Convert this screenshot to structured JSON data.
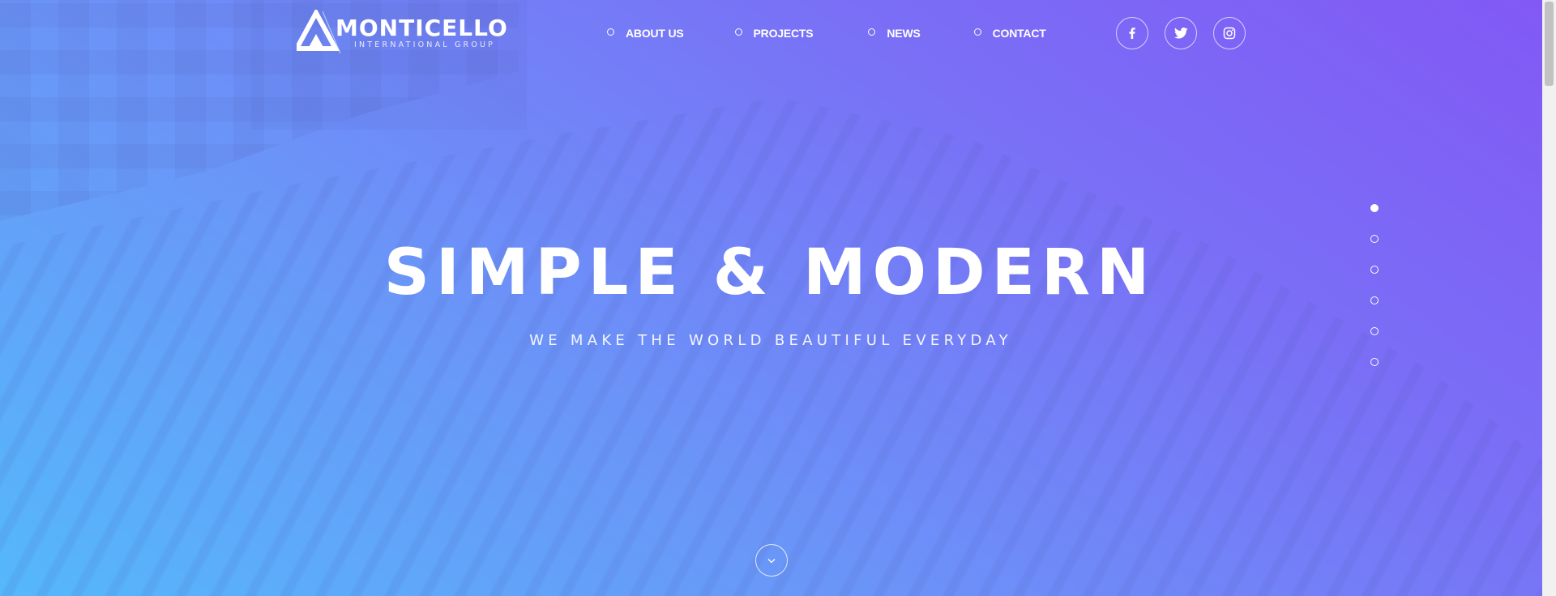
{
  "brand": {
    "name": "MONTICELLO",
    "tagline": "INTERNATIONAL GROUP"
  },
  "nav": {
    "items": [
      {
        "label": "ABOUT US"
      },
      {
        "label": "PROJECTS"
      },
      {
        "label": "NEWS"
      },
      {
        "label": "CONTACT"
      }
    ]
  },
  "social": {
    "icons": [
      "facebook-icon",
      "twitter-icon",
      "instagram-icon"
    ]
  },
  "hero": {
    "title": "SIMPLE & MODERN",
    "subtitle": "WE MAKE THE WORLD BEAUTIFUL EVERYDAY"
  },
  "slider": {
    "total": 6,
    "active_index": 0
  },
  "colors": {
    "gradient_start": "#55b8fb",
    "gradient_end": "#8258f5",
    "text": "#ffffff"
  }
}
